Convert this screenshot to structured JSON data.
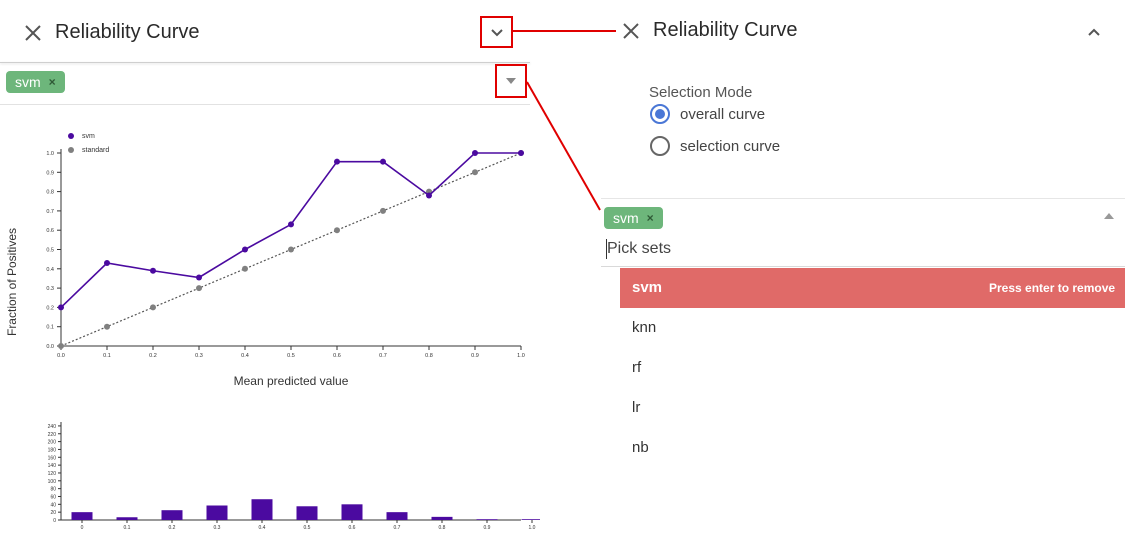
{
  "left_panel": {
    "title": "Reliability Curve",
    "chip_label": "svm",
    "chip_remove": "×"
  },
  "right_panel": {
    "title": "Reliability Curve",
    "selection_mode_label": "Selection Mode",
    "radio_options": [
      "overall curve",
      "selection curve"
    ],
    "selected_radio": "overall curve",
    "chip_label": "svm",
    "chip_remove": "×",
    "search_placeholder": "Pick sets",
    "highlighted_option": "svm",
    "highlight_hint": "Press enter to remove",
    "options": [
      "knn",
      "rf",
      "lr",
      "nb"
    ]
  },
  "colors": {
    "svm": "#4b0aa0",
    "standard": "#808080",
    "chip": "#6db67b",
    "highlight": "#e06a68",
    "annotation": "#e00000",
    "radio": "#4a77d6"
  },
  "chart_data": [
    {
      "type": "line",
      "xlabel": "Mean predicted value",
      "ylabel": "Fraction of Positives",
      "xlim": [
        0,
        1
      ],
      "ylim": [
        0,
        1
      ],
      "x_ticks": [
        "0.0",
        "0.1",
        "0.2",
        "0.3",
        "0.4",
        "0.5",
        "0.6",
        "0.7",
        "0.8",
        "0.9",
        "1.0"
      ],
      "y_ticks": [
        "0.0",
        "0.1",
        "0.2",
        "0.3",
        "0.4",
        "0.5",
        "0.6",
        "0.7",
        "0.8",
        "0.9",
        "1.0"
      ],
      "legend": "top-left",
      "series": [
        {
          "name": "svm",
          "x": [
            0.0,
            0.1,
            0.2,
            0.3,
            0.4,
            0.5,
            0.6,
            0.7,
            0.8,
            0.9,
            1.0
          ],
          "values": [
            0.2,
            0.43,
            0.39,
            0.355,
            0.5,
            0.63,
            0.955,
            0.955,
            0.78,
            1.0,
            1.0
          ]
        },
        {
          "name": "standard",
          "x": [
            0.0,
            0.1,
            0.2,
            0.3,
            0.4,
            0.5,
            0.6,
            0.7,
            0.8,
            0.9,
            1.0
          ],
          "values": [
            0.0,
            0.1,
            0.2,
            0.3,
            0.4,
            0.5,
            0.6,
            0.7,
            0.8,
            0.9,
            1.0
          ]
        }
      ]
    },
    {
      "type": "bar",
      "categories": [
        "0",
        "0.1",
        "0.2",
        "0.3",
        "0.4",
        "0.5",
        "0.6",
        "0.7",
        "0.8",
        "0.9",
        "1.0"
      ],
      "values": [
        20,
        7,
        25,
        37,
        53,
        35,
        40,
        20,
        8,
        2,
        2
      ],
      "y_ticks": [
        "0",
        "20",
        "40",
        "60",
        "80",
        "100",
        "120",
        "140",
        "160",
        "180",
        "200",
        "220",
        "240"
      ],
      "ylim": [
        0,
        250
      ]
    }
  ]
}
